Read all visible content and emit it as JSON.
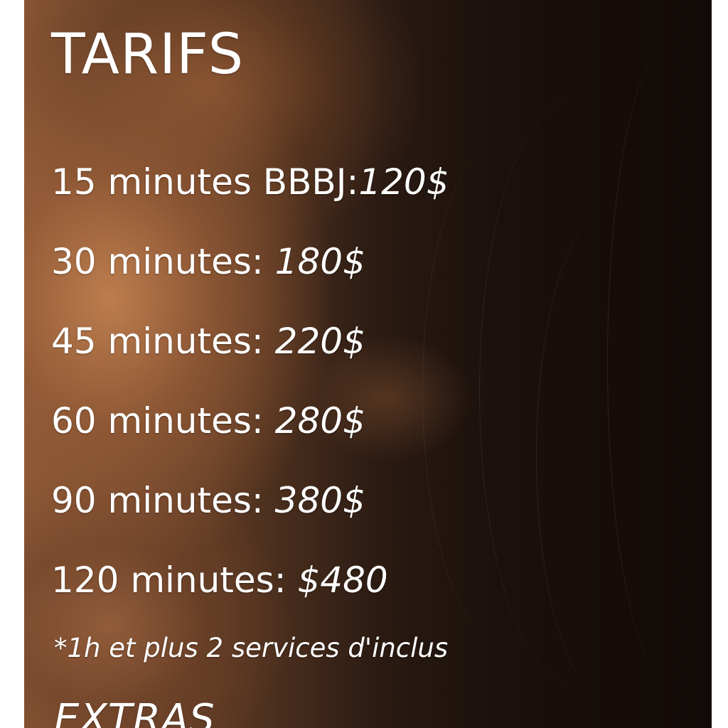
{
  "title": "TARIFS",
  "rates": [
    {
      "duration": "15 minutes BBBJ:",
      "price": "120$"
    },
    {
      "duration": "30 minutes: ",
      "price": "180$"
    },
    {
      "duration": "45 minutes: ",
      "price": "220$"
    },
    {
      "duration": "60 minutes: ",
      "price": "280$"
    },
    {
      "duration": "90 minutes: ",
      "price": "380$"
    },
    {
      "duration": "120 minutes: ",
      "price": "$480"
    }
  ],
  "note": "*1h et plus 2 services d'inclus",
  "extras_heading": "EXTRAS",
  "colors": {
    "text": "#ffffff",
    "background_dark": "#120a08",
    "skin_tone": "#8a5634",
    "page_margin": "#ffffff"
  }
}
